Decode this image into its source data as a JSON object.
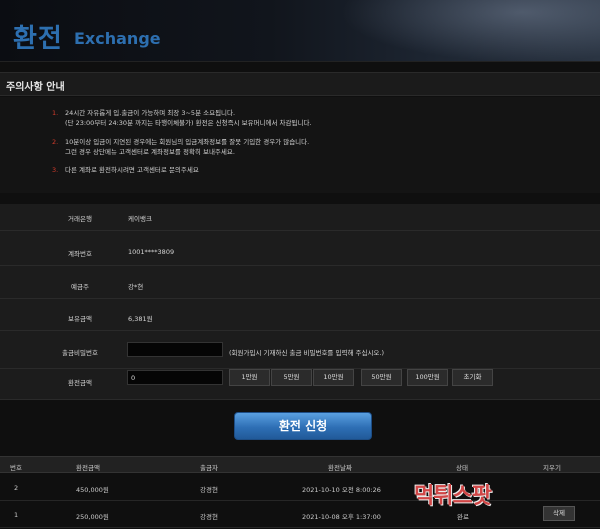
{
  "header": {
    "title_ko": "환전",
    "title_en": "Exchange"
  },
  "notice": {
    "title": "주의사항 안내",
    "items": [
      {
        "num": "1.",
        "lines": [
          "24시간 자유롭게 입.출금이 가능하며 최장 3~5분 소요됩니다.",
          "(단 23:00부터 24:30분 까지는 타행이체불가) 환전은 신청즉시 보유머니에서 차감됩니다."
        ]
      },
      {
        "num": "2.",
        "lines": [
          "10분이상 입금이 지연된 경우에는 회원님의 입금계좌정보를 잘못 기입한 경우가 많습니다.",
          "그런 경우 상단메뉴 고객센터로 계좌정보를 정확히 보내주세요."
        ]
      },
      {
        "num": "3.",
        "lines": [
          "다른 계좌로 환전하시려면 고객센터로 문의주세요"
        ]
      }
    ]
  },
  "form": {
    "bank_label": "거래은행",
    "bank_value": "케이뱅크",
    "account_label": "계좌번호",
    "account_value": "1001****3809",
    "holder_label": "예금주",
    "holder_value": "강*현",
    "balance_label": "보유금액",
    "balance_value": "6,381원",
    "password_label": "출금비밀번호",
    "password_hint": "(회원가입시 기재하신 출금 비밀번호를 입력해 주십시오.)",
    "amount_label": "환전금액",
    "amount_value": "0",
    "amount_buttons": [
      "1만원",
      "5만원",
      "10만원",
      "50만원",
      "100만원",
      "초기화"
    ]
  },
  "submit_label": "환전 신청",
  "table": {
    "headers": [
      "번호",
      "환전금액",
      "출금자",
      "환전날짜",
      "상태",
      "지우기"
    ],
    "rows": [
      {
        "no": "2",
        "amount": "450,000원",
        "name": "강경현",
        "date": "2021-10-10 오전 8:00:26",
        "status": "",
        "action": ""
      },
      {
        "no": "1",
        "amount": "250,000원",
        "name": "강경현",
        "date": "2021-10-08 오후 1:37:00",
        "status": "완료",
        "action": "삭제"
      }
    ]
  },
  "watermark": "먹튀스팟"
}
